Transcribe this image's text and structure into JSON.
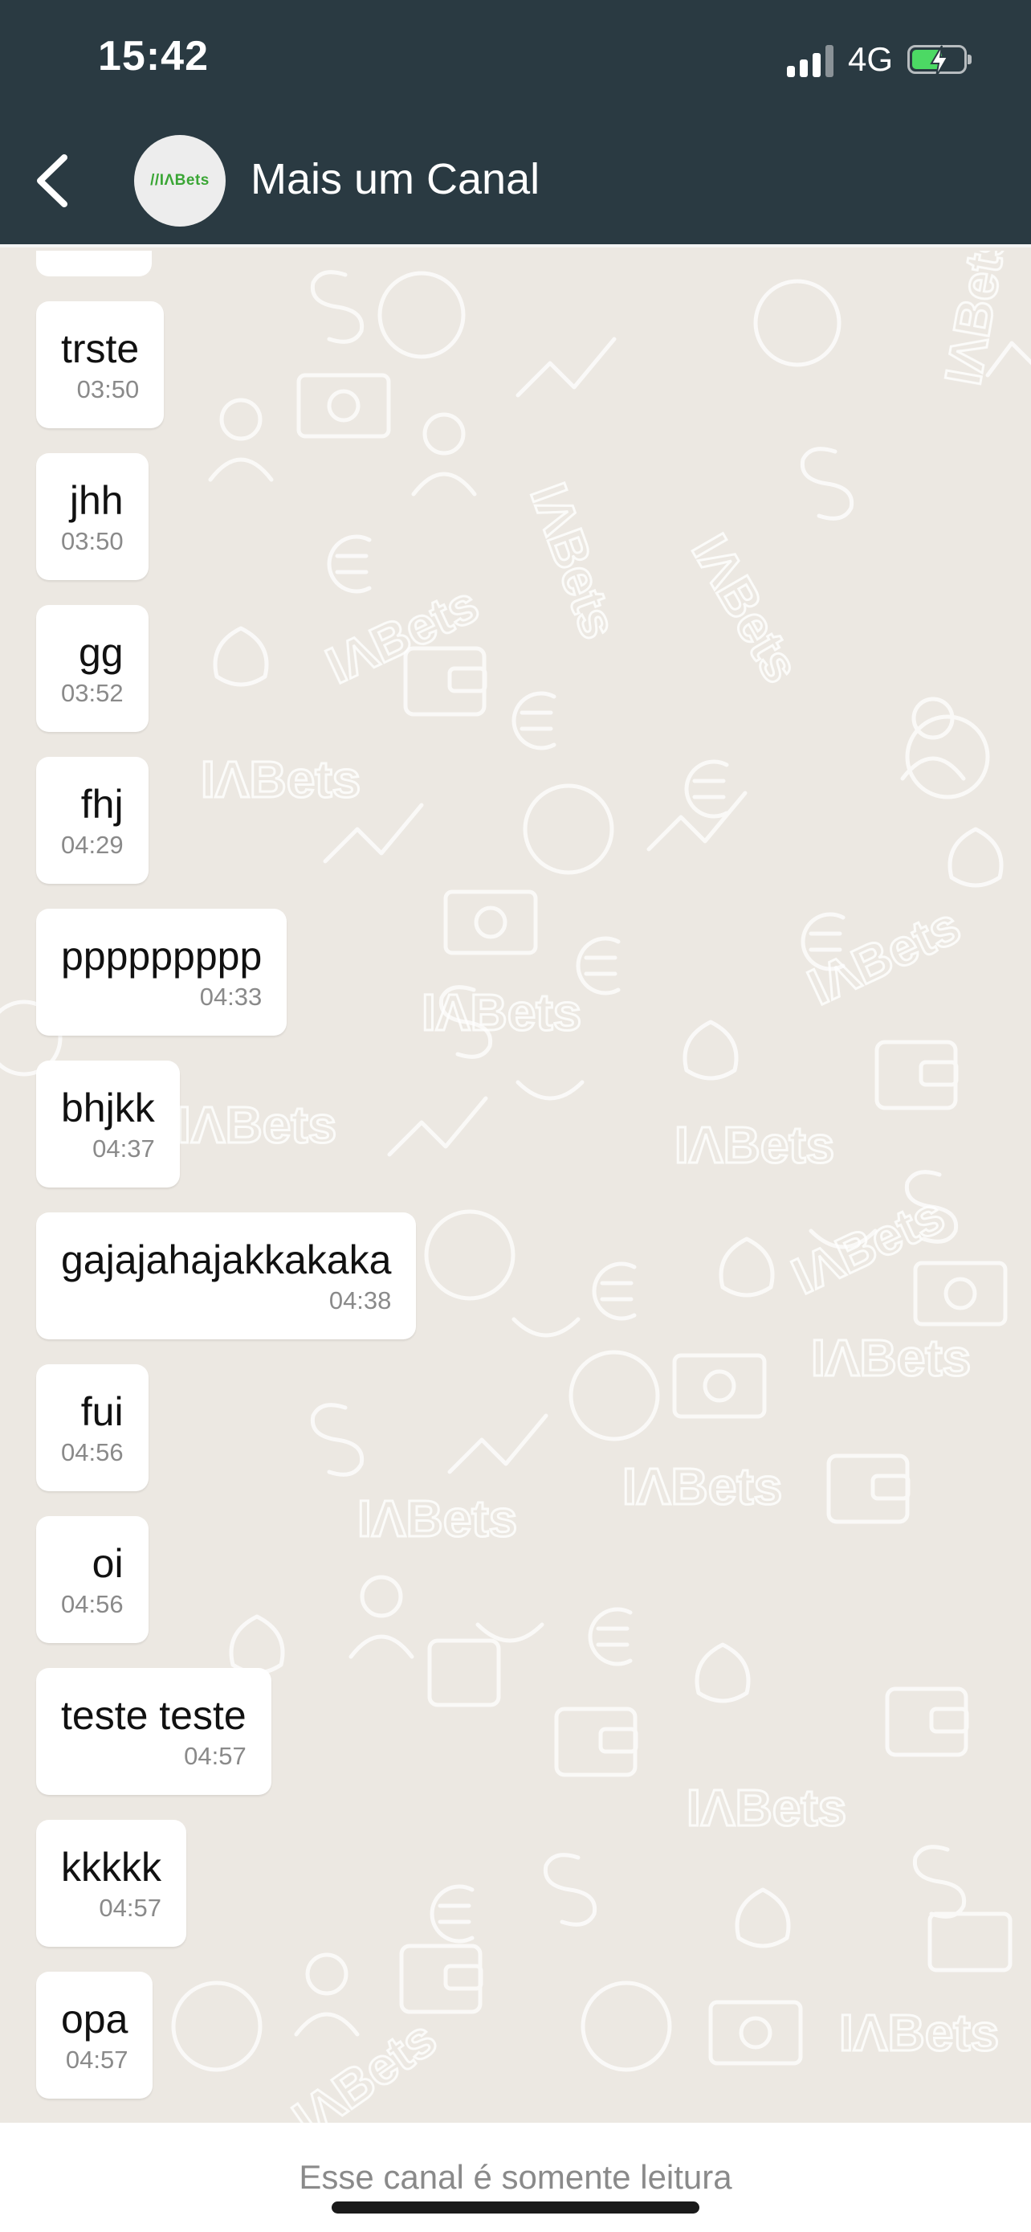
{
  "status_bar": {
    "time": "15:42",
    "network": "4G",
    "battery_charging": true
  },
  "header": {
    "avatar_logo": "//IΛBets",
    "title": "Mais um Canal"
  },
  "messages": [
    {
      "text": "trste",
      "time": "03:50"
    },
    {
      "text": "jhh",
      "time": "03:50"
    },
    {
      "text": "gg",
      "time": "03:52"
    },
    {
      "text": "fhj",
      "time": "04:29"
    },
    {
      "text": "ppppppppp",
      "time": "04:33"
    },
    {
      "text": "bhjkk",
      "time": "04:37"
    },
    {
      "text": "gajajahajakkakaka",
      "time": "04:38"
    },
    {
      "text": "fui",
      "time": "04:56"
    },
    {
      "text": "oi",
      "time": "04:56"
    },
    {
      "text": "teste teste",
      "time": "04:57"
    },
    {
      "text": "kkkkk",
      "time": "04:57"
    },
    {
      "text": "opa",
      "time": "04:57"
    }
  ],
  "background_watermark": "IΛBets",
  "footer": {
    "read_only_notice": "Esse canal é somente leitura"
  },
  "colors": {
    "header_bg": "#2a3a42",
    "chat_bg": "#ece8e2",
    "bubble_bg": "#ffffff",
    "brand_green": "#3aa635"
  }
}
